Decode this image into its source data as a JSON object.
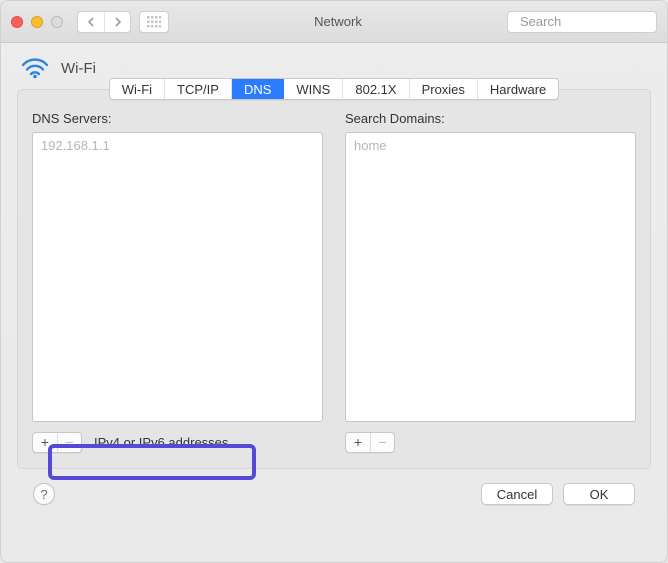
{
  "window": {
    "title": "Network"
  },
  "search": {
    "placeholder": "Search"
  },
  "heading": {
    "label": "Wi-Fi"
  },
  "tabs": [
    {
      "label": "Wi-Fi"
    },
    {
      "label": "TCP/IP"
    },
    {
      "label": "DNS",
      "active": true
    },
    {
      "label": "WINS"
    },
    {
      "label": "802.1X"
    },
    {
      "label": "Proxies"
    },
    {
      "label": "Hardware"
    }
  ],
  "dns": {
    "label": "DNS Servers:",
    "items": [
      "192.168.1.1"
    ],
    "hint": "IPv4 or IPv6 addresses"
  },
  "domains": {
    "label": "Search Domains:",
    "items": [
      "home"
    ]
  },
  "buttons": {
    "plus": "+",
    "minus": "−",
    "help": "?",
    "cancel": "Cancel",
    "ok": "OK"
  }
}
